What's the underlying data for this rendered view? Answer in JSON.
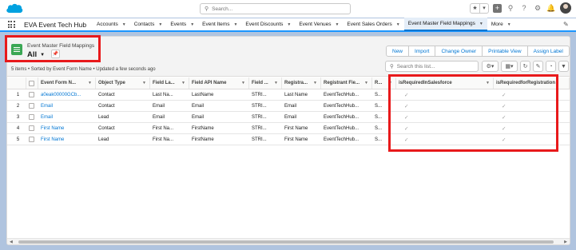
{
  "header": {
    "search_placeholder": "Search...",
    "icons": [
      "salesforce-cloud-logo",
      "search-icon",
      "favorites-star-icon",
      "dropdown-icon",
      "add-icon",
      "setup-assistant-icon",
      "help-icon",
      "gear-icon",
      "notification-bell-icon",
      "avatar"
    ]
  },
  "nav": {
    "app_name": "EVA Event Tech Hub",
    "items": [
      {
        "label": "Accounts"
      },
      {
        "label": "Contacts"
      },
      {
        "label": "Events"
      },
      {
        "label": "Event Items"
      },
      {
        "label": "Event Discounts"
      },
      {
        "label": "Event Venues"
      },
      {
        "label": "Event Sales Orders"
      },
      {
        "label": "Event Master Field Mappings"
      }
    ],
    "more_label": "More"
  },
  "list_view": {
    "object_label": "Event Master Field Mappings",
    "view_name": "All",
    "meta": "5 items • Sorted by Event Form Name • Updated a few seconds ago",
    "buttons": [
      "New",
      "Import",
      "Change Owner",
      "Printable View",
      "Assign Label"
    ],
    "search_placeholder": "Search this list..."
  },
  "table": {
    "columns": [
      "Event Form N...",
      "Object Type",
      "Field La...",
      "Field API Name",
      "Field ...",
      "Registra...",
      "Registrant Fie...",
      "R...",
      "isRequiredInSalesforce",
      "isRequiredforRegistration"
    ],
    "rows": [
      {
        "num": "1",
        "form_name": "a0eak00000GCb...",
        "object_type": "Contact",
        "field_label": "Last Na...",
        "api_name": "LastName",
        "field_type": "STRI...",
        "registrant": "Last Name",
        "registrant_field": "EventTechHub...",
        "r": "S...",
        "req_sf": true,
        "req_reg": true
      },
      {
        "num": "2",
        "form_name": "Email",
        "object_type": "Contact",
        "field_label": "Email",
        "api_name": "Email",
        "field_type": "STRI...",
        "registrant": "Email",
        "registrant_field": "EventTechHub...",
        "r": "S...",
        "req_sf": true,
        "req_reg": true
      },
      {
        "num": "3",
        "form_name": "Email",
        "object_type": "Lead",
        "field_label": "Email",
        "api_name": "Email",
        "field_type": "STRI...",
        "registrant": "Email",
        "registrant_field": "EventTechHub...",
        "r": "S...",
        "req_sf": true,
        "req_reg": true
      },
      {
        "num": "4",
        "form_name": "First Name",
        "object_type": "Contact",
        "field_label": "First Na...",
        "api_name": "FirstName",
        "field_type": "STRI...",
        "registrant": "First Name",
        "registrant_field": "EventTechHub...",
        "r": "S...",
        "req_sf": true,
        "req_reg": true
      },
      {
        "num": "5",
        "form_name": "First Name",
        "object_type": "Lead",
        "field_label": "First Na...",
        "api_name": "FirstName",
        "field_type": "STRI...",
        "registrant": "First Name",
        "registrant_field": "EventTechHub...",
        "r": "S...",
        "req_sf": true,
        "req_reg": true
      }
    ]
  },
  "colors": {
    "highlight": "#e8191b",
    "brand_blue": "#0176d3",
    "object_icon": "#3ba755",
    "background": "#b0c4df"
  }
}
